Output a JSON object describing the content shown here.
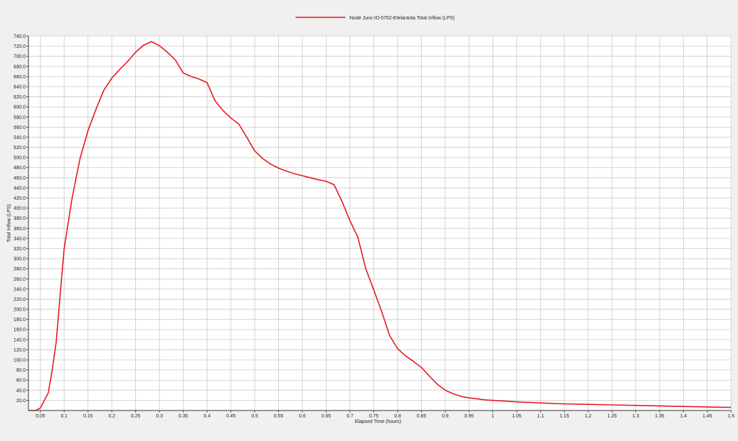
{
  "chart_data": {
    "type": "line",
    "title": "",
    "xlabel": "Elapsed Time (hours)",
    "ylabel": "Total Inflow (LPS)",
    "xlim": [
      0.025,
      1.5
    ],
    "ylim": [
      0,
      740
    ],
    "xticks": [
      0.05,
      0.1,
      0.15,
      0.2,
      0.25,
      0.3,
      0.35,
      0.4,
      0.45,
      0.5,
      0.55,
      0.6,
      0.65,
      0.7,
      0.75,
      0.8,
      0.85,
      0.9,
      0.95,
      1,
      1.05,
      1.1,
      1.15,
      1.2,
      1.25,
      1.3,
      1.35,
      1.4,
      1.45,
      1.5
    ],
    "xtick_labels": [
      "0.05",
      "0.1",
      "0.15",
      "0.2",
      "0.25",
      "0.3",
      "0.35",
      "0.4",
      "0.45",
      "0.5",
      "0.55",
      "0.6",
      "0.65",
      "0.7",
      "0.75",
      "0.8",
      "0.85",
      "0.9",
      "0.95",
      "1",
      "1.05",
      "1.1",
      "1.15",
      "1.2",
      "1.25",
      "1.3",
      "1.35",
      "1.4",
      "1.45",
      "1.5"
    ],
    "yticks": [
      20,
      40,
      60,
      80,
      100,
      120,
      140,
      160,
      180,
      200,
      220,
      240,
      260,
      280,
      300,
      320,
      340,
      360,
      380,
      400,
      420,
      440,
      460,
      480,
      500,
      520,
      540,
      560,
      580,
      600,
      620,
      640,
      660,
      680,
      700,
      720,
      740
    ],
    "ytick_labels": [
      "20.0",
      "40.0",
      "60.0",
      "80.0",
      "100.0",
      "120.0",
      "140.0",
      "160.0",
      "180.0",
      "200.0",
      "220.0",
      "240.0",
      "260.0",
      "280.0",
      "300.0",
      "320.0",
      "340.0",
      "360.0",
      "380.0",
      "400.0",
      "420.0",
      "440.0",
      "460.0",
      "480.0",
      "500.0",
      "520.0",
      "540.0",
      "560.0",
      "580.0",
      "600.0",
      "620.0",
      "640.0",
      "660.0",
      "680.0",
      "700.0",
      "720.0",
      "740.0"
    ],
    "grid": true,
    "legend_position": "top-center",
    "series": [
      {
        "name": "Node Junc-ID-5752-Etelaranta Total Inflow (LPS)",
        "color": "#e8141c",
        "x": [
          0.025,
          0.04,
          0.05,
          0.0667,
          0.075,
          0.0833,
          0.0917,
          0.1,
          0.1083,
          0.1167,
          0.125,
          0.1333,
          0.15,
          0.1667,
          0.1833,
          0.2,
          0.2167,
          0.2333,
          0.25,
          0.2667,
          0.2833,
          0.3,
          0.3167,
          0.3333,
          0.35,
          0.3667,
          0.3833,
          0.4,
          0.4167,
          0.4333,
          0.45,
          0.4667,
          0.4833,
          0.5,
          0.5167,
          0.5333,
          0.55,
          0.5667,
          0.5833,
          0.6,
          0.6167,
          0.6333,
          0.65,
          0.6667,
          0.6833,
          0.7,
          0.7167,
          0.7333,
          0.75,
          0.7667,
          0.7833,
          0.8,
          0.8167,
          0.8333,
          0.85,
          0.8667,
          0.8833,
          0.9,
          0.9167,
          0.9333,
          0.95,
          0.9667,
          0.9833,
          1,
          1.0167,
          1.05,
          1.1,
          1.15,
          1.2,
          1.25,
          1.3,
          1.35,
          1.4,
          1.45,
          1.5
        ],
        "values": [
          0,
          0,
          5,
          35,
          80,
          135,
          230,
          320,
          370,
          420,
          460,
          498,
          553,
          595,
          633,
          657,
          674,
          690,
          708,
          722,
          729,
          721,
          708,
          693,
          667,
          660,
          655,
          648,
          612,
          593,
          578,
          566,
          540,
          513,
          498,
          487,
          479,
          473,
          468,
          464,
          460,
          456,
          453,
          446,
          413,
          375,
          342,
          280,
          238,
          195,
          148,
          122,
          108,
          97,
          85,
          68,
          52,
          40,
          33,
          28,
          25,
          23,
          21,
          20,
          19,
          17,
          15,
          13,
          12,
          11,
          10,
          9,
          8,
          7,
          6
        ]
      }
    ]
  }
}
